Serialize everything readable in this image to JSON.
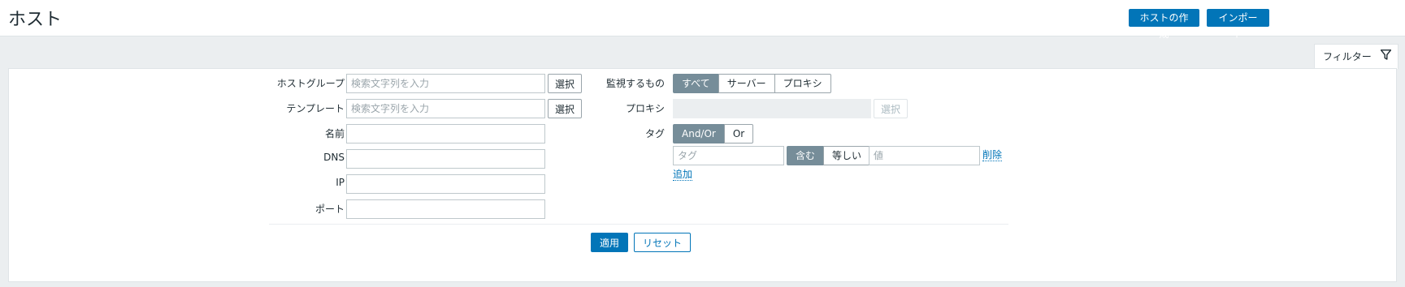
{
  "header": {
    "title": "ホスト",
    "create_host_label": "ホストの作成",
    "import_label": "インポート"
  },
  "filter_tab": {
    "label": "フィルター",
    "icon": "filter-funnel-icon"
  },
  "filter": {
    "host_groups": {
      "label": "ホストグループ",
      "placeholder": "検索文字列を入力",
      "select_label": "選択"
    },
    "templates": {
      "label": "テンプレート",
      "placeholder": "検索文字列を入力",
      "select_label": "選択"
    },
    "name": {
      "label": "名前",
      "value": ""
    },
    "dns": {
      "label": "DNS",
      "value": ""
    },
    "ip": {
      "label": "IP",
      "value": ""
    },
    "port": {
      "label": "ポート",
      "value": ""
    },
    "monitored_by": {
      "label": "監視するもの",
      "options": [
        "すべて",
        "サーバー",
        "プロキシ"
      ],
      "selected": "すべて"
    },
    "proxy": {
      "label": "プロキシ",
      "value": "",
      "select_label": "選択"
    },
    "tags": {
      "label": "タグ",
      "operator_options": [
        "And/Or",
        "Or"
      ],
      "operator_selected": "And/Or",
      "tag_placeholder": "タグ",
      "match_options": [
        "含む",
        "等しい"
      ],
      "match_selected": "含む",
      "value_placeholder": "値",
      "remove_label": "削除",
      "add_label": "追加"
    },
    "apply_label": "適用",
    "reset_label": "リセット"
  },
  "colors": {
    "primary": "#0275b8",
    "segment_active": "#768d99",
    "background": "#ebeef0"
  }
}
